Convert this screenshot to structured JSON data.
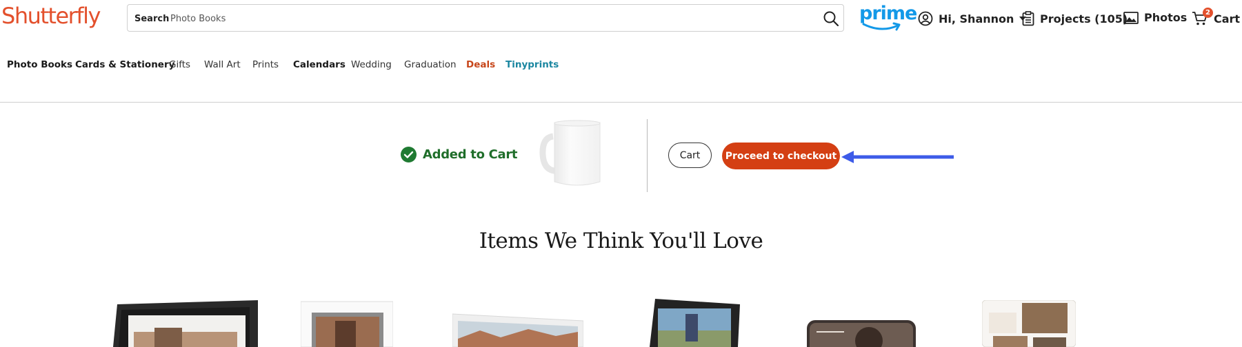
{
  "header": {
    "logo": "Shutterfly",
    "search_label": "Search",
    "search_value": "Photo Books",
    "prime": "prime",
    "greeting": "Hi, Shannon",
    "projects": "Projects (105)",
    "photos": "Photos",
    "cart": "Cart",
    "cart_count": "2"
  },
  "nav": {
    "items": [
      "Photo Books",
      "Cards & Stationery",
      "Gifts",
      "Wall Art",
      "Prints",
      "Calendars",
      "Wedding",
      "Graduation",
      "Deals",
      "Tinyprints"
    ]
  },
  "confirmation": {
    "status": "Added to Cart",
    "cart_button": "Cart",
    "checkout_button": "Proceed to checkout"
  },
  "recommendations": {
    "title": "Items We Think You'll Love"
  },
  "colors": {
    "brand": "#e3502c",
    "checkout": "#d43f13",
    "success": "#1f6e2a",
    "prime": "#1399e8",
    "deals": "#c7461a",
    "tinyprints": "#1a86a0",
    "annotation_arrow": "#3d5be8"
  },
  "icons": [
    "search-icon",
    "prime-smile-icon",
    "user-circle-icon",
    "caret-down-icon",
    "clipboard-icon",
    "photo-icon",
    "cart-icon",
    "check-circle-icon",
    "mug-image",
    "annotation-arrow"
  ]
}
